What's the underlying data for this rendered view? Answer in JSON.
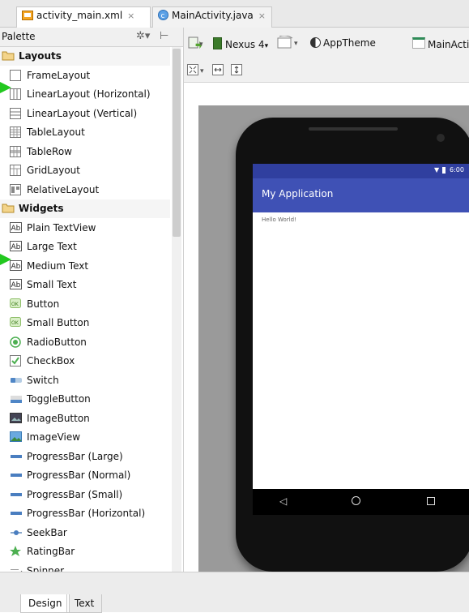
{
  "tabs": [
    {
      "label": "activity_main.xml",
      "active": true,
      "close": "×"
    },
    {
      "label": "MainActivity.java",
      "active": false,
      "close": "×"
    }
  ],
  "palette": {
    "title": "Palette",
    "items": [
      {
        "label": "Layouts",
        "category": true,
        "icon": "folder-icon"
      },
      {
        "label": "FrameLayout",
        "icon": "frame-layout-icon"
      },
      {
        "label": "LinearLayout (Horizontal)",
        "icon": "linear-horizontal-icon"
      },
      {
        "label": "LinearLayout (Vertical)",
        "icon": "linear-vertical-icon"
      },
      {
        "label": "TableLayout",
        "icon": "table-layout-icon"
      },
      {
        "label": "TableRow",
        "icon": "table-row-icon"
      },
      {
        "label": "GridLayout",
        "icon": "grid-layout-icon"
      },
      {
        "label": "RelativeLayout",
        "icon": "relative-layout-icon"
      },
      {
        "label": "Widgets",
        "category": true,
        "icon": "folder-icon"
      },
      {
        "label": "Plain TextView",
        "icon": "text-ab-icon"
      },
      {
        "label": "Large Text",
        "icon": "text-ab-icon"
      },
      {
        "label": "Medium Text",
        "icon": "text-ab-icon"
      },
      {
        "label": "Small Text",
        "icon": "text-ab-icon"
      },
      {
        "label": "Button",
        "icon": "ok-button-icon"
      },
      {
        "label": "Small Button",
        "icon": "ok-button-icon"
      },
      {
        "label": "RadioButton",
        "icon": "radio-icon"
      },
      {
        "label": "CheckBox",
        "icon": "checkbox-icon"
      },
      {
        "label": "Switch",
        "icon": "switch-icon"
      },
      {
        "label": "ToggleButton",
        "icon": "toggle-icon"
      },
      {
        "label": "ImageButton",
        "icon": "image-button-icon"
      },
      {
        "label": "ImageView",
        "icon": "image-view-icon"
      },
      {
        "label": "ProgressBar (Large)",
        "icon": "progress-icon"
      },
      {
        "label": "ProgressBar (Normal)",
        "icon": "progress-icon"
      },
      {
        "label": "ProgressBar (Small)",
        "icon": "progress-icon"
      },
      {
        "label": "ProgressBar (Horizontal)",
        "icon": "progress-icon"
      },
      {
        "label": "SeekBar",
        "icon": "seekbar-icon"
      },
      {
        "label": "RatingBar",
        "icon": "star-icon"
      },
      {
        "label": "Spinner",
        "icon": "spinner-icon"
      }
    ]
  },
  "toolbar": {
    "device": "Nexus 4",
    "theme": "AppTheme",
    "activity": "MainActi"
  },
  "phone": {
    "time": "6:00",
    "app_title": "My Application",
    "content_text": "Hello World!"
  },
  "bottom_tabs": [
    {
      "label": "Design",
      "active": true
    },
    {
      "label": "Text",
      "active": false
    }
  ],
  "colors": {
    "accent_arrow": "#22c81f",
    "app_bar": "#3f51b5",
    "status_bar": "#303f9f"
  }
}
